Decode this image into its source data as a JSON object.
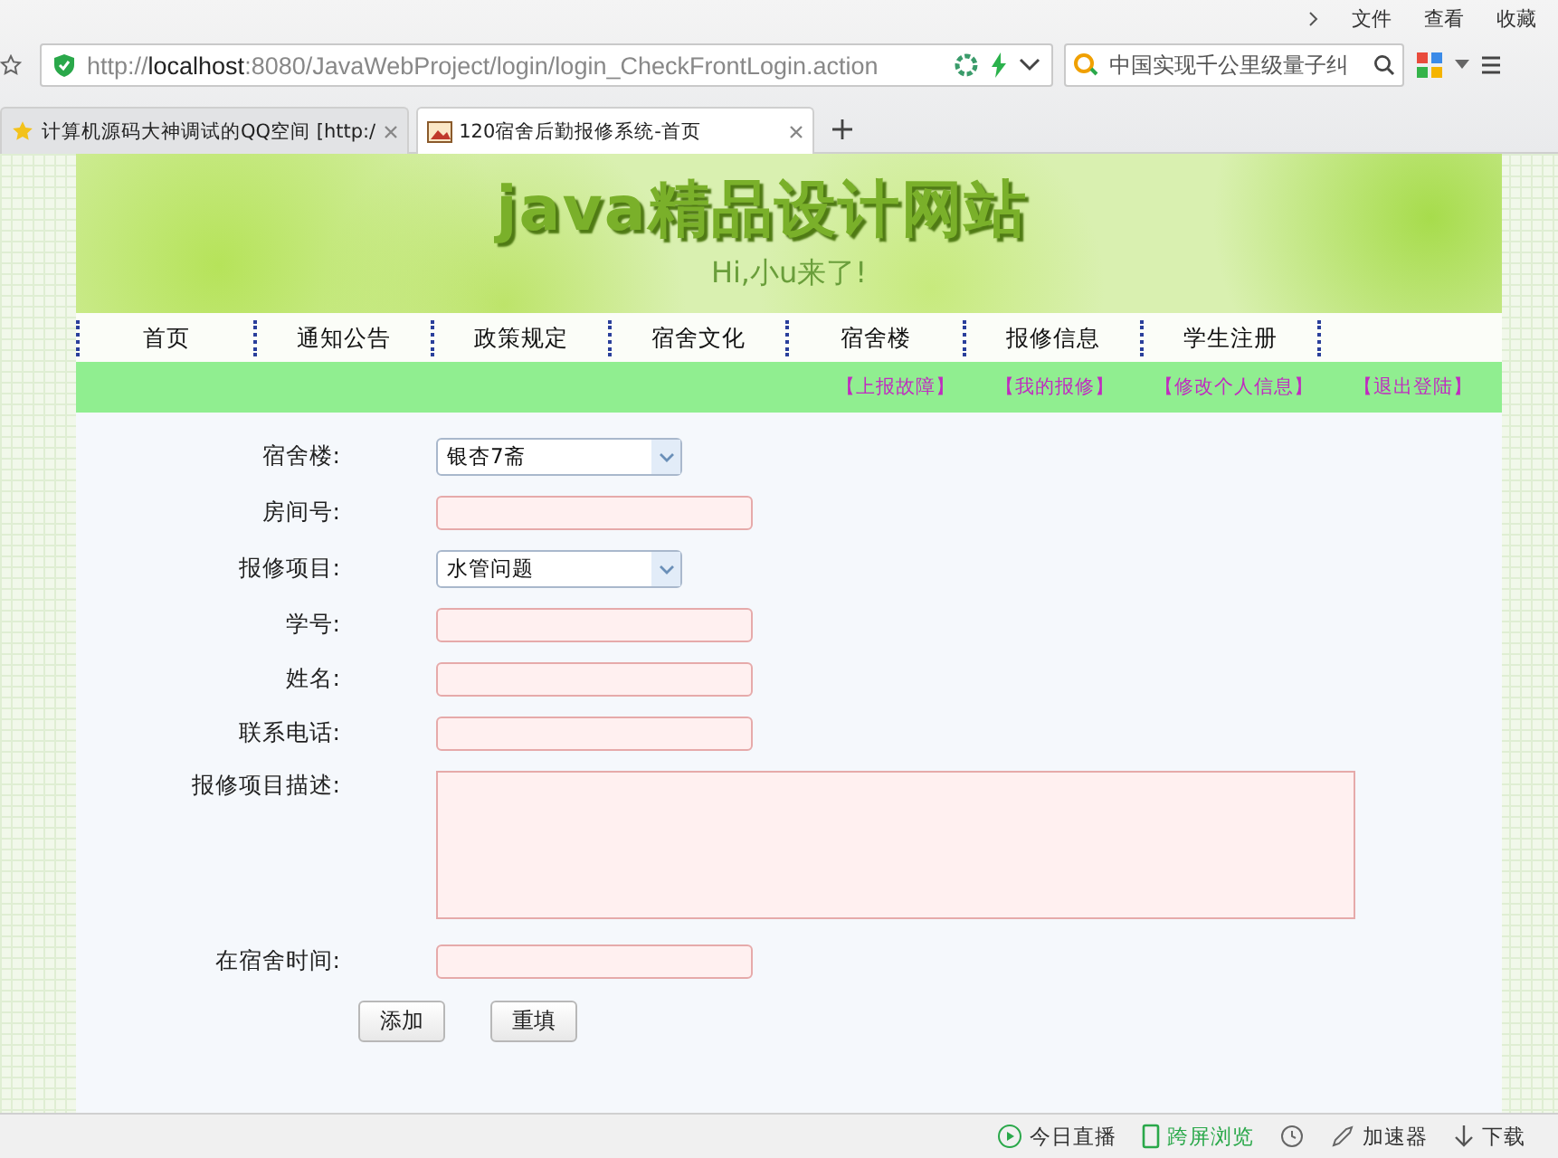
{
  "browser": {
    "menu": [
      "文件",
      "查看",
      "收藏"
    ],
    "address": "http://**localhost**:8080/JavaWebProject/login/login_CheckFrontLogin.action",
    "search_placeholder": "中国实现千公里级量子纠",
    "tabs": [
      {
        "label": "计算机源码大神调试的QQ空间 [http:/",
        "selected": false
      },
      {
        "label": "120宿舍后勤报修系统-首页",
        "selected": true
      }
    ]
  },
  "banner": {
    "title": "java精品设计网站",
    "subtitle": "Hi,小u来了!"
  },
  "nav": [
    "首页",
    "通知公告",
    "政策规定",
    "宿舍文化",
    "宿舍楼",
    "报修信息",
    "学生注册"
  ],
  "actions": [
    "【上报故障】",
    "【我的报修】",
    "【修改个人信息】",
    "【退出登陆】"
  ],
  "form": {
    "fields": [
      {
        "label": "宿舍楼:",
        "kind": "select",
        "value": "银杏7斋"
      },
      {
        "label": "房间号:",
        "kind": "input"
      },
      {
        "label": "报修项目:",
        "kind": "select",
        "value": "水管问题"
      },
      {
        "label": "学号:",
        "kind": "input"
      },
      {
        "label": "姓名:",
        "kind": "input"
      },
      {
        "label": "联系电话:",
        "kind": "input"
      },
      {
        "label": "报修项目描述:",
        "kind": "textarea"
      },
      {
        "label": "在宿舍时间:",
        "kind": "input"
      }
    ],
    "buttons": [
      "添加",
      "重填"
    ]
  },
  "status_bar": [
    "今日直播",
    "跨屏浏览",
    "加速器",
    "下载"
  ]
}
